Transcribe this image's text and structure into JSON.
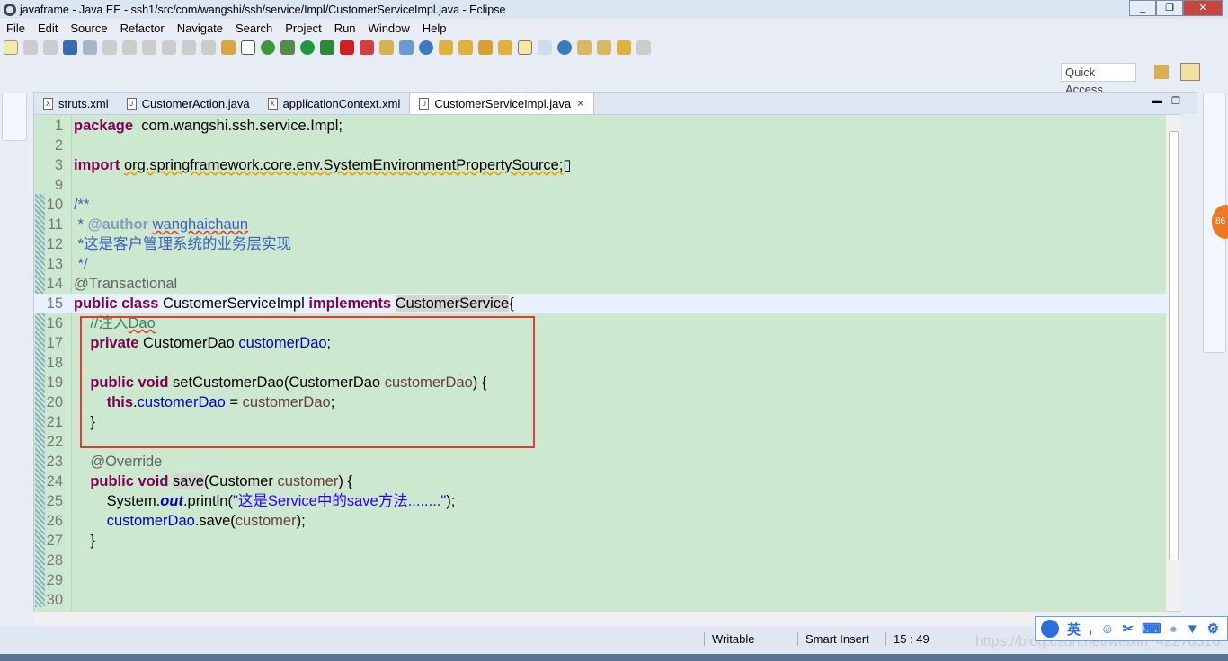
{
  "window": {
    "title": "javaframe - Java EE - ssh1/src/com/wangshi/ssh/service/Impl/CustomerServiceImpl.java - Eclipse"
  },
  "menu": [
    "File",
    "Edit",
    "Source",
    "Refactor",
    "Navigate",
    "Search",
    "Project",
    "Run",
    "Window",
    "Help"
  ],
  "quick_access": "Quick Access",
  "tabs": [
    {
      "label": "struts.xml",
      "icon": "X"
    },
    {
      "label": "CustomerAction.java",
      "icon": "J"
    },
    {
      "label": "applicationContext.xml",
      "icon": "X"
    },
    {
      "label": "CustomerServiceImpl.java",
      "icon": "J",
      "active": true
    }
  ],
  "code": [
    {
      "n": "1",
      "t": [
        [
          "kw",
          "package"
        ],
        [
          "",
          "  com.wangshi.ssh.service.Impl;"
        ]
      ]
    },
    {
      "n": "2",
      "t": []
    },
    {
      "n": "3",
      "t": [
        [
          "kw",
          "import"
        ],
        [
          "",
          " "
        ],
        [
          "sq",
          "org.springframework.core.env.SystemEnvironmentPropertySource;"
        ],
        [
          "",
          "▯"
        ]
      ]
    },
    {
      "n": "9",
      "t": []
    },
    {
      "n": "10",
      "t": [
        [
          "cm",
          "/**"
        ]
      ]
    },
    {
      "n": "11",
      "t": [
        [
          "cm",
          " * "
        ],
        [
          "tag",
          "@author"
        ],
        [
          "cm",
          " "
        ],
        [
          "cm sqr",
          "wanghaichaun"
        ]
      ]
    },
    {
      "n": "12",
      "t": [
        [
          "cm",
          " *这是客户管理系统的业务层实现"
        ]
      ]
    },
    {
      "n": "13",
      "t": [
        [
          "cm",
          " */"
        ]
      ]
    },
    {
      "n": "14",
      "t": [
        [
          "an",
          "@Transactional"
        ]
      ]
    },
    {
      "n": "15",
      "cur": true,
      "t": [
        [
          "kw",
          "public class"
        ],
        [
          "",
          " CustomerServiceImpl "
        ],
        [
          "kw",
          "implements"
        ],
        [
          "",
          " "
        ],
        [
          "hl",
          "CustomerService"
        ],
        [
          "",
          "{"
        ]
      ]
    },
    {
      "n": "16",
      "t": [
        [
          "sc",
          "    //注入"
        ],
        [
          "sc sqr",
          "Dao"
        ]
      ]
    },
    {
      "n": "17",
      "t": [
        [
          "",
          "    "
        ],
        [
          "kw",
          "private"
        ],
        [
          "",
          " CustomerDao "
        ],
        [
          "fd",
          "customerDao"
        ],
        [
          "",
          ";"
        ]
      ]
    },
    {
      "n": "18",
      "t": []
    },
    {
      "n": "19",
      "t": [
        [
          "",
          "    "
        ],
        [
          "kw",
          "public void"
        ],
        [
          "",
          " setCustomerDao(CustomerDao "
        ],
        [
          "pr",
          "customerDao"
        ],
        [
          "",
          ") {"
        ]
      ]
    },
    {
      "n": "20",
      "t": [
        [
          "",
          "        "
        ],
        [
          "kw",
          "this"
        ],
        [
          "",
          "."
        ],
        [
          "fd",
          "customerDao"
        ],
        [
          "",
          " = "
        ],
        [
          "pr",
          "customerDao"
        ],
        [
          "",
          ";"
        ]
      ]
    },
    {
      "n": "21",
      "t": [
        [
          "",
          "    }"
        ]
      ]
    },
    {
      "n": "22",
      "t": []
    },
    {
      "n": "23",
      "t": [
        [
          "an",
          "    @Override"
        ]
      ]
    },
    {
      "n": "24",
      "t": [
        [
          "",
          "    "
        ],
        [
          "kw",
          "public void"
        ],
        [
          "",
          " "
        ],
        [
          "hl",
          "save"
        ],
        [
          "",
          "(Customer "
        ],
        [
          "pr",
          "customer"
        ],
        [
          "",
          ") {"
        ]
      ]
    },
    {
      "n": "25",
      "t": [
        [
          "",
          "        System."
        ],
        [
          "it",
          "out"
        ],
        [
          "",
          ".println("
        ],
        [
          "st",
          "\"这是Service中的save方法........\""
        ],
        [
          "",
          ");"
        ]
      ]
    },
    {
      "n": "26",
      "t": [
        [
          "",
          "        "
        ],
        [
          "fd",
          "customerDao"
        ],
        [
          "",
          ".save("
        ],
        [
          "pr",
          "customer"
        ],
        [
          "",
          ");"
        ]
      ]
    },
    {
      "n": "27",
      "t": [
        [
          "",
          "    }"
        ]
      ]
    },
    {
      "n": "28",
      "t": []
    },
    {
      "n": "29",
      "t": []
    },
    {
      "n": "30",
      "t": []
    }
  ],
  "status": {
    "writable": "Writable",
    "insert_mode": "Smart Insert",
    "position": "15 : 49"
  },
  "ime": {
    "lang": "英"
  },
  "watermark": "https://blog.csdn.net/weixin_42278316"
}
